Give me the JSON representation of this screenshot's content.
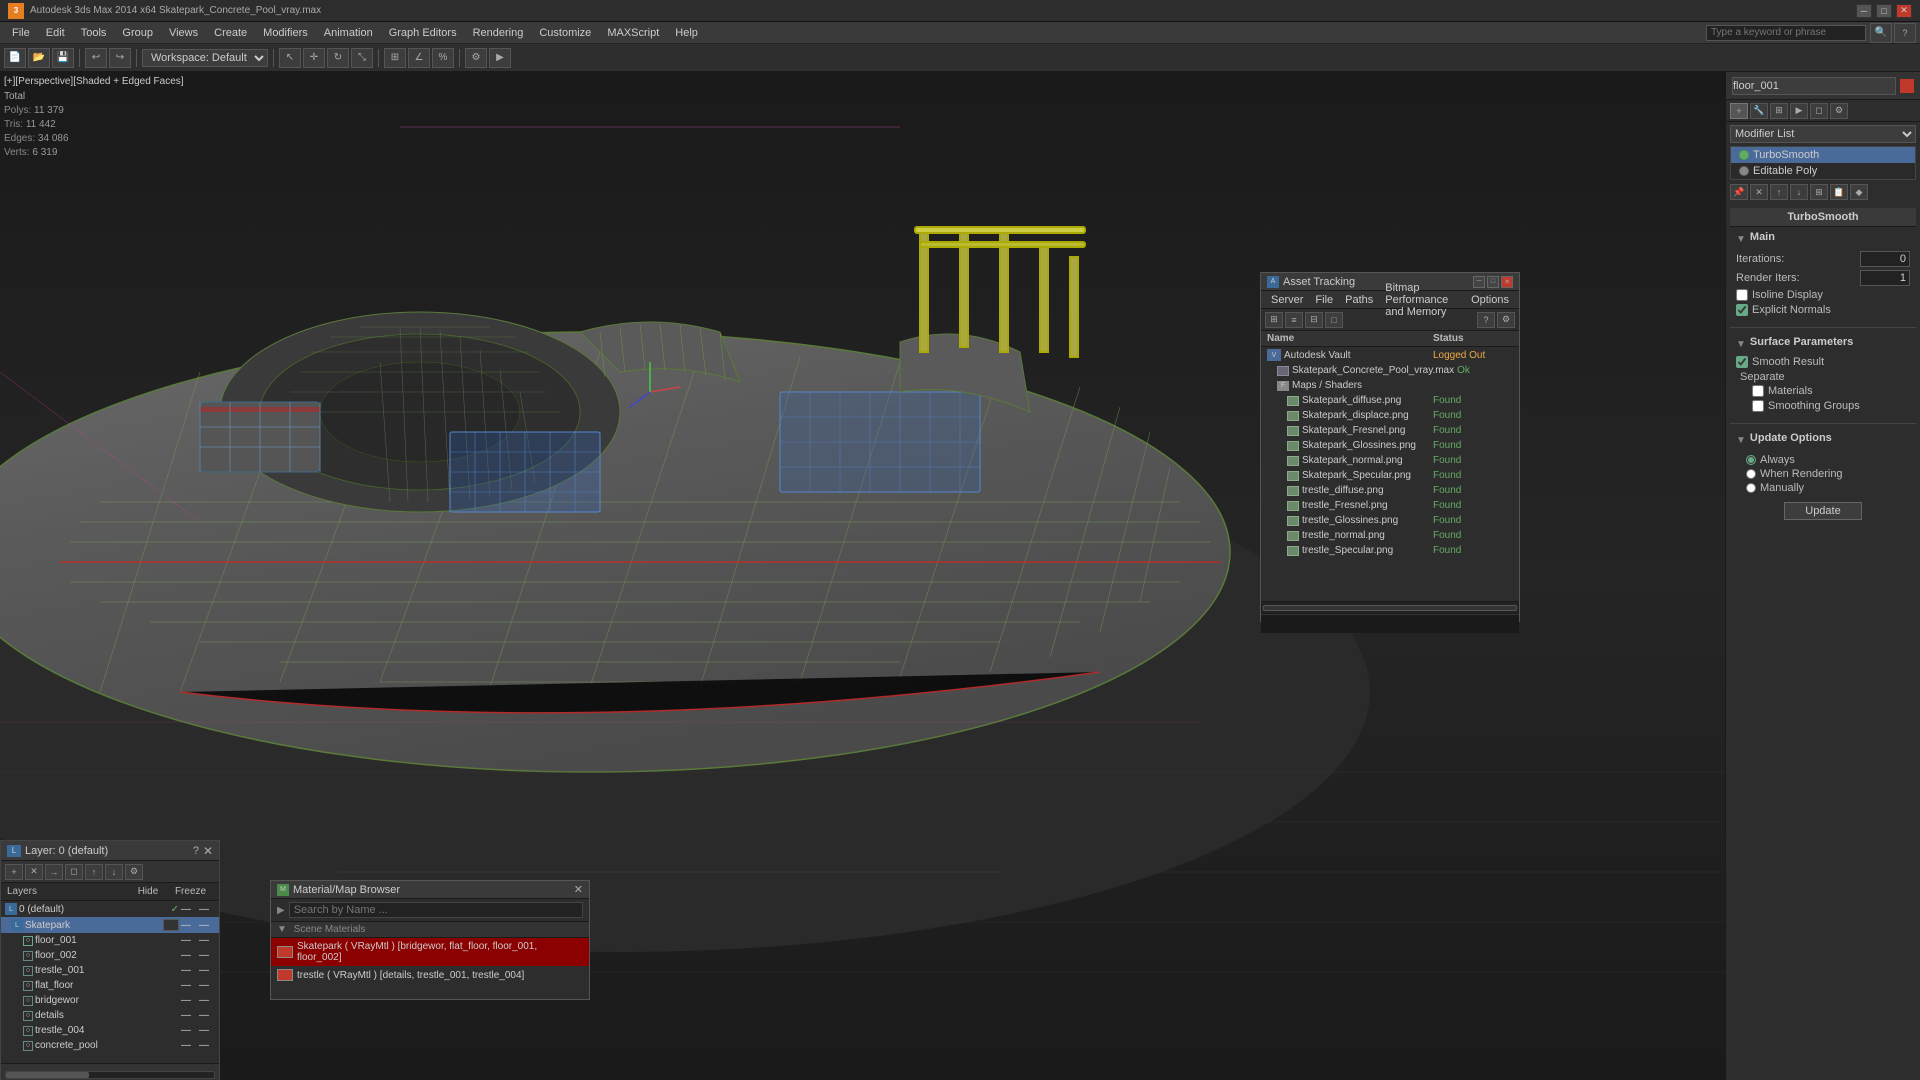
{
  "titlebar": {
    "app_name": "3ds Max",
    "app_version": "Autodesk 3ds Max 2014 x64",
    "filename": "Skatepark_Concrete_Pool_vray.max",
    "title": "Autodesk 3ds Max 2014 x64     Skatepark_Concrete_Pool_vray.max",
    "workspace_label": "Workspace: Default",
    "close_label": "✕",
    "min_label": "─",
    "max_label": "□"
  },
  "menubar": {
    "items": [
      "File",
      "Edit",
      "Tools",
      "Group",
      "Views",
      "Create",
      "Modifiers",
      "Animation",
      "Graph Editors",
      "Rendering",
      "Customize",
      "MAXScript",
      "Help"
    ]
  },
  "viewport": {
    "label": "[+][Perspective][Shaded + Edged Faces]",
    "stats": {
      "polys_label": "Polys:",
      "polys_value": "11 379",
      "tris_label": "Tris:",
      "tris_value": "11 442",
      "edges_label": "Edges:",
      "edges_value": "34 086",
      "verts_label": "Verts:",
      "verts_value": "6 319"
    }
  },
  "right_panel": {
    "object_name": "floor_001",
    "dropdown_value": "Modifier List",
    "modifier_stack": [
      {
        "name": "TurboSmooth",
        "active": true
      },
      {
        "name": "Editable Poly",
        "active": false
      }
    ],
    "turbosmooth": {
      "title": "TurboSmooth",
      "main_section": "Main",
      "iterations_label": "Iterations:",
      "iterations_value": "0",
      "render_iters_label": "Render Iters:",
      "render_iters_value": "1",
      "isoline_display_label": "Isoline Display",
      "isoline_checked": false,
      "explicit_normals_label": "Explicit Normals",
      "explicit_normals_checked": true,
      "surface_params_label": "Surface Parameters",
      "smooth_result_label": "Smooth Result",
      "smooth_result_checked": true,
      "separate_label": "Separate",
      "materials_label": "Materials",
      "materials_checked": false,
      "smoothing_groups_label": "Smoothing Groups",
      "smoothing_groups_checked": false,
      "update_options_label": "Update Options",
      "always_label": "Always",
      "when_rendering_label": "When Rendering",
      "manually_label": "Manually",
      "update_btn_label": "Update"
    }
  },
  "layers": {
    "title": "Layer: 0 (default)",
    "help_label": "?",
    "close_label": "✕",
    "layers_label": "Layers",
    "hide_label": "Hide",
    "freeze_label": "Freeze",
    "items": [
      {
        "name": "0 (default)",
        "indent": 0,
        "type": "layer",
        "active": false
      },
      {
        "name": "Skatepark",
        "indent": 1,
        "type": "layer",
        "selected": true
      },
      {
        "name": "floor_001",
        "indent": 2,
        "type": "object"
      },
      {
        "name": "floor_002",
        "indent": 2,
        "type": "object"
      },
      {
        "name": "trestle_001",
        "indent": 2,
        "type": "object"
      },
      {
        "name": "flat_floor",
        "indent": 2,
        "type": "object"
      },
      {
        "name": "bridgewor",
        "indent": 2,
        "type": "object"
      },
      {
        "name": "details",
        "indent": 2,
        "type": "object"
      },
      {
        "name": "trestle_004",
        "indent": 2,
        "type": "object"
      },
      {
        "name": "concrete_pool",
        "indent": 2,
        "type": "object"
      }
    ]
  },
  "material_browser": {
    "title": "Material/Map Browser",
    "close_label": "✕",
    "search_placeholder": "Search by Name ...",
    "section_label": "Scene Materials",
    "materials": [
      {
        "name": "Skatepark ( VRayMtl ) [bridgewor, flat_floor, floor_001, floor_002]",
        "selected": true
      },
      {
        "name": "trestle ( VRayMtl ) [details, trestle_001, trestle_004]",
        "selected": false
      }
    ]
  },
  "asset_tracking": {
    "title": "Asset Tracking",
    "close_label": "✕",
    "min_label": "─",
    "max_label": "□",
    "menu_items": [
      "Server",
      "File",
      "Paths",
      "Bitmap Performance and Memory",
      "Options"
    ],
    "col_name": "Name",
    "col_status": "Status",
    "items": [
      {
        "name": "Autodesk Vault",
        "status": "Logged Out",
        "indent": 0,
        "type": "vault"
      },
      {
        "name": "Skatepark_Concrete_Pool_vray.max",
        "status": "Ok",
        "indent": 1,
        "type": "file"
      },
      {
        "name": "Maps / Shaders",
        "status": "",
        "indent": 1,
        "type": "folder"
      },
      {
        "name": "Skatepark_diffuse.png",
        "status": "Found",
        "indent": 2,
        "type": "map"
      },
      {
        "name": "Skatepark_displace.png",
        "status": "Found",
        "indent": 2,
        "type": "map"
      },
      {
        "name": "Skatepark_Fresnel.png",
        "status": "Found",
        "indent": 2,
        "type": "map"
      },
      {
        "name": "Skatepark_Glossines.png",
        "status": "Found",
        "indent": 2,
        "type": "map"
      },
      {
        "name": "Skatepark_normal.png",
        "status": "Found",
        "indent": 2,
        "type": "map"
      },
      {
        "name": "Skatepark_Specular.png",
        "status": "Found",
        "indent": 2,
        "type": "map"
      },
      {
        "name": "trestle_diffuse.png",
        "status": "Found",
        "indent": 2,
        "type": "map"
      },
      {
        "name": "trestle_Fresnel.png",
        "status": "Found",
        "indent": 2,
        "type": "map"
      },
      {
        "name": "trestle_Glossines.png",
        "status": "Found",
        "indent": 2,
        "type": "map"
      },
      {
        "name": "trestle_normal.png",
        "status": "Found",
        "indent": 2,
        "type": "map"
      },
      {
        "name": "trestle_Specular.png",
        "status": "Found",
        "indent": 2,
        "type": "map"
      }
    ]
  },
  "icons": {
    "check": "✓",
    "close": "✕",
    "arrow_right": "▶",
    "arrow_down": "▼",
    "question": "?",
    "bulb": "●",
    "folder": "📁",
    "file": "📄",
    "plus": "+",
    "minus": "─",
    "search": "🔍"
  }
}
